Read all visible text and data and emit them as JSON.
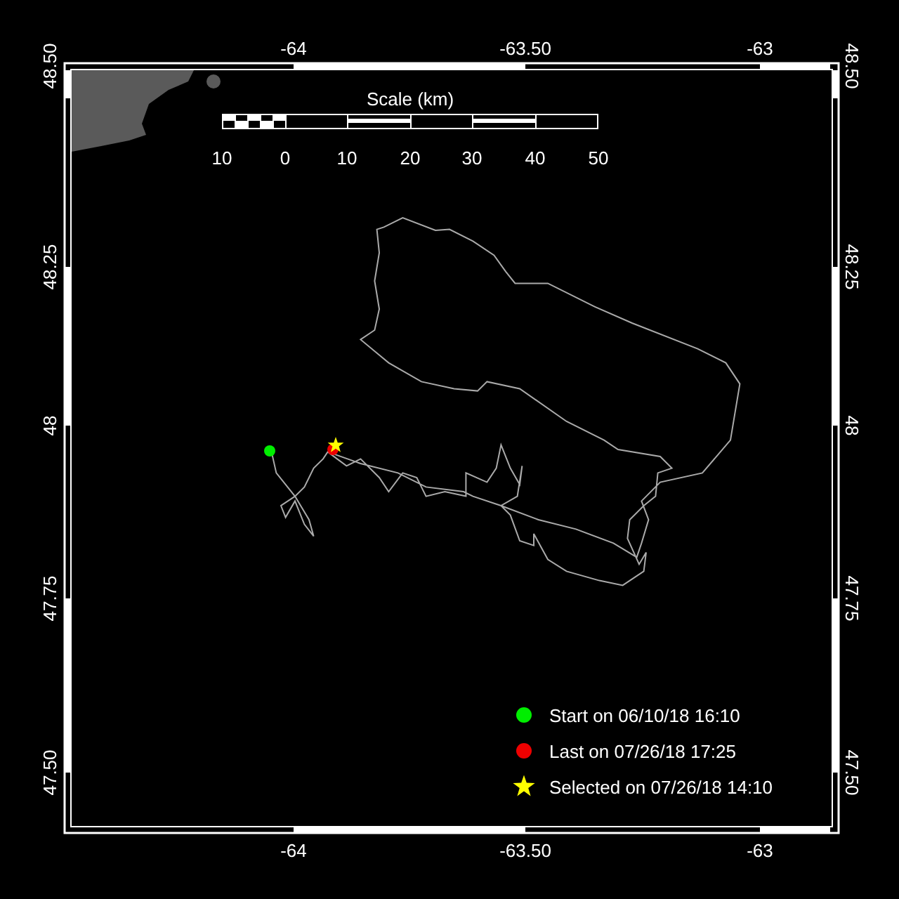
{
  "map": {
    "top_axis_labels": [
      "-64",
      "-63.50",
      "-63"
    ],
    "bottom_axis_labels": [
      "-64",
      "-63.50",
      "-63"
    ],
    "left_axis_labels": [
      "48.50",
      "48.25",
      "48",
      "47.75",
      "47.50"
    ],
    "right_axis_labels": [
      "48.50",
      "48.25",
      "48",
      "47.75",
      "47.50"
    ],
    "scale_bar": {
      "title": "Scale (km)",
      "tick_labels": [
        "10",
        "0",
        "10",
        "20",
        "30",
        "40",
        "50"
      ]
    },
    "markers": [
      {
        "kind": "dot",
        "color": "#00ee00"
      },
      {
        "kind": "dot",
        "color": "#ee0000"
      },
      {
        "kind": "star",
        "color": "#ffff00"
      }
    ],
    "legend": [
      {
        "kind": "dot",
        "color": "#00ee00",
        "label": "Start on 06/10/18 16:10"
      },
      {
        "kind": "dot",
        "color": "#ee0000",
        "label": "Last on 07/26/18 17:25"
      },
      {
        "kind": "star",
        "color": "#ffff00",
        "label": "Selected on 07/26/18 14:10"
      }
    ]
  }
}
